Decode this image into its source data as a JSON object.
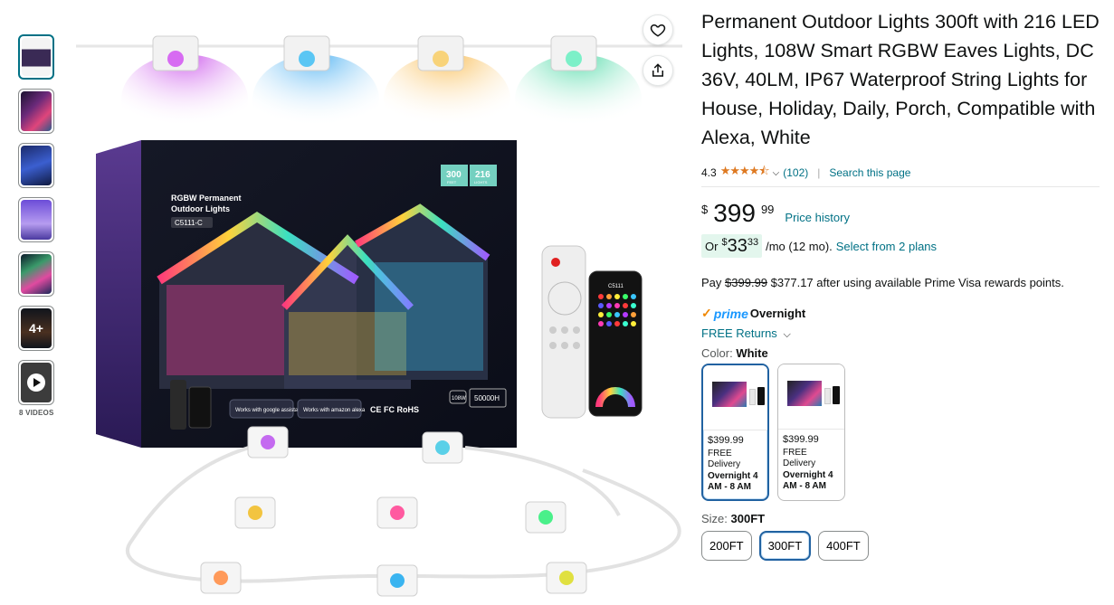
{
  "thumbnails": [
    {
      "name": "product-box",
      "active": true
    },
    {
      "name": "house-colors"
    },
    {
      "name": "app-feature"
    },
    {
      "name": "lights-purple"
    },
    {
      "name": "house-night"
    },
    {
      "name": "more-images",
      "overlay": "4+"
    },
    {
      "name": "video",
      "type": "video"
    }
  ],
  "videos_label": "8 VIDEOS",
  "main_image": {
    "box_heading": "RGBW Permanent\nOutdoor Lights",
    "box_model": "C5111-C",
    "badge_feet": "300",
    "badge_feet_unit": "FEET",
    "badge_lights": "216",
    "badge_lights_unit": "LIGHTS",
    "works_google": "Works with google assistant",
    "works_alexa": "Works with amazon alexa",
    "cert": "CE FC RoHS",
    "watt": "108W",
    "hours": "50000H",
    "phone_model": "C5111"
  },
  "product": {
    "title": "Permanent Outdoor Lights 300ft with 216 LED Lights, 108W Smart RGBW Eaves Lights, DC 36V, 40LM, IP67 Waterproof String Lights for House, Holiday, Daily, Porch, Compatible with Alexa, White",
    "rating": "4.3",
    "stars": "★★★★⯪",
    "review_count": "(102)",
    "search_link": "Search this page",
    "price_symbol": "$",
    "price_whole": "399",
    "price_fraction": "99",
    "price_history": "Price history",
    "plan_or": "Or",
    "plan_symbol": "$",
    "plan_whole": "33",
    "plan_fraction": "33",
    "plan_suffix": "/mo (12 mo).",
    "plan_link": "Select from 2 plans",
    "pay_prefix": "Pay",
    "pay_strike": "$399.99",
    "pay_rest": "$377.17 after using available Prime Visa rewards points.",
    "prime_check": "✓",
    "prime_word": "prime",
    "prime_speed": "Overnight",
    "free_returns": "FREE Returns",
    "color_label": "Color:",
    "color_value": "White",
    "swatches": [
      {
        "price": "$399.99",
        "delivery": "FREE Delivery",
        "speed": "Overnight 4 AM - 8 AM",
        "selected": true
      },
      {
        "price": "$399.99",
        "delivery": "FREE Delivery",
        "speed": "Overnight 4 AM - 8 AM",
        "selected": false
      }
    ],
    "size_label": "Size:",
    "size_value": "300FT",
    "sizes": [
      "200FT",
      "300FT",
      "400FT"
    ]
  },
  "colors": {
    "link": "#007185",
    "star": "#de7921",
    "selected_border": "#2162a1",
    "plan_bg": "#e3f6ed"
  }
}
